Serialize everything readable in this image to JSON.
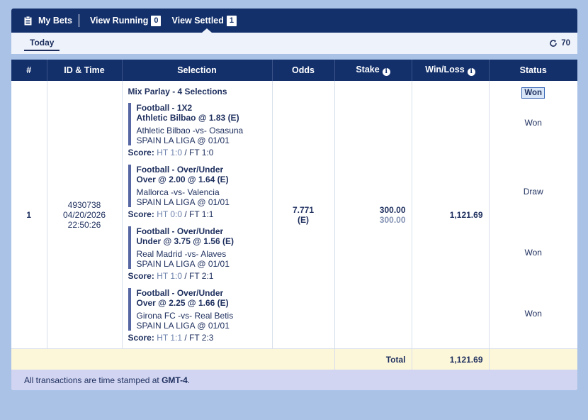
{
  "nav": {
    "my_bets": "My Bets",
    "view_running": "View Running",
    "running_count": "0",
    "view_settled": "View Settled",
    "settled_count": "1"
  },
  "subbar": {
    "tab_today": "Today",
    "refresh_count": "70"
  },
  "table": {
    "headers": [
      "#",
      "ID & Time",
      "Selection",
      "Odds",
      "Stake",
      "Win/Loss",
      "Status"
    ],
    "row": {
      "num": "1",
      "id": "4930738",
      "date": "04/20/2026",
      "time": "22:50:26",
      "parlay_title": "Mix Parlay - 4 Selections",
      "odds": "7.771",
      "odds_suffix": "(E)",
      "stake": "300.00",
      "stake_sub": "300.00",
      "win_loss": "1,121.69",
      "overall_status": "Won",
      "legs": [
        {
          "market": "Football - 1X2",
          "pick": "Athletic Bilbao @ 1.83 (E)",
          "match": "Athletic Bilbao -vs- Osasuna",
          "league": "SPAIN LA LIGA @ 01/01",
          "score_label": "Score:",
          "ht": "HT 1:0",
          "ft": "FT 1:0",
          "status": "Won"
        },
        {
          "market": "Football - Over/Under",
          "pick": "Over @ 2.00 @ 1.64 (E)",
          "match": "Mallorca -vs- Valencia",
          "league": "SPAIN LA LIGA @ 01/01",
          "score_label": "Score:",
          "ht": "HT 0:0",
          "ft": "FT 1:1",
          "status": "Draw"
        },
        {
          "market": "Football - Over/Under",
          "pick": "Under @ 3.75 @ 1.56 (E)",
          "match": "Real Madrid -vs- Alaves",
          "league": "SPAIN LA LIGA @ 01/01",
          "score_label": "Score:",
          "ht": "HT 1:0",
          "ft": "FT 2:1",
          "status": "Won"
        },
        {
          "market": "Football - Over/Under",
          "pick": "Over @ 2.25 @ 1.66 (E)",
          "match": "Girona FC -vs- Real Betis",
          "league": "SPAIN LA LIGA @ 01/01",
          "score_label": "Score:",
          "ht": "HT 1:1",
          "ft": "FT 2:3",
          "status": "Won"
        }
      ]
    },
    "total_label": "Total",
    "total_value": "1,121.69"
  },
  "footer": {
    "text_prefix": "All transactions are time stamped at ",
    "timezone": "GMT-4",
    "text_suffix": "."
  }
}
